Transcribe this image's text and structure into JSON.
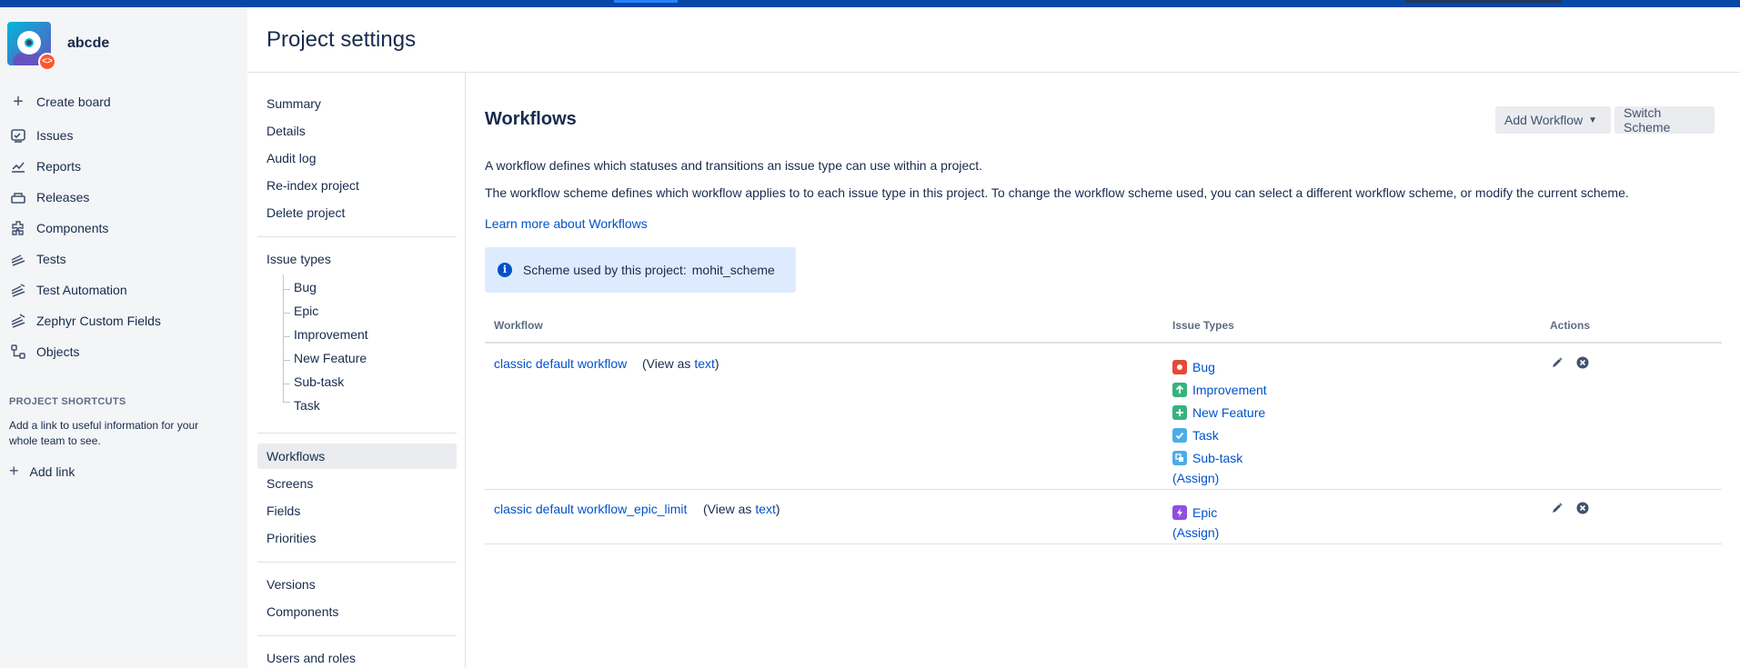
{
  "project": {
    "name": "abcde"
  },
  "sidebar": {
    "create_board": "Create board",
    "items": [
      {
        "label": "Issues",
        "icon": "issues-icon"
      },
      {
        "label": "Reports",
        "icon": "reports-icon"
      },
      {
        "label": "Releases",
        "icon": "releases-icon"
      },
      {
        "label": "Components",
        "icon": "components-icon"
      },
      {
        "label": "Tests",
        "icon": "tests-icon"
      },
      {
        "label": "Test Automation",
        "icon": "test-automation-icon"
      },
      {
        "label": "Zephyr Custom Fields",
        "icon": "zephyr-custom-fields-icon"
      },
      {
        "label": "Objects",
        "icon": "objects-icon"
      }
    ],
    "shortcuts_title": "PROJECT SHORTCUTS",
    "shortcuts_desc": "Add a link to useful information for your whole team to see.",
    "add_link": "Add link"
  },
  "page": {
    "title": "Project settings"
  },
  "settings_nav": {
    "summary": "Summary",
    "details": "Details",
    "audit_log": "Audit log",
    "reindex": "Re-index project",
    "delete": "Delete project",
    "issue_types": "Issue types",
    "issue_type_children": [
      "Bug",
      "Epic",
      "Improvement",
      "New Feature",
      "Sub-task",
      "Task"
    ],
    "workflows": "Workflows",
    "screens": "Screens",
    "fields": "Fields",
    "priorities": "Priorities",
    "versions": "Versions",
    "components": "Components",
    "users_roles": "Users and roles"
  },
  "main": {
    "title": "Workflows",
    "add_workflow": "Add Workflow",
    "switch_scheme": "Switch Scheme",
    "desc1": "A workflow defines which statuses and transitions an issue type can use within a project.",
    "desc2": "The workflow scheme defines which workflow applies to to each issue type in this project. To change the workflow scheme used, you can select a different workflow scheme, or modify the current scheme.",
    "learn_more": "Learn more about Workflows",
    "scheme_label": "Scheme used by this project:",
    "scheme_name": "mohit_scheme"
  },
  "table": {
    "col_workflow": "Workflow",
    "col_issue_types": "Issue Types",
    "col_actions": "Actions",
    "view_prefix": "(View as ",
    "view_link": "text",
    "view_suffix": ")",
    "assign": "(Assign)",
    "rows": [
      {
        "name": "classic default workflow",
        "issue_types": [
          {
            "label": "Bug",
            "color": "#e5493a"
          },
          {
            "label": "Improvement",
            "color": "#36b37e"
          },
          {
            "label": "New Feature",
            "color": "#36b37e"
          },
          {
            "label": "Task",
            "color": "#4bade8"
          },
          {
            "label": "Sub-task",
            "color": "#4bade8"
          }
        ]
      },
      {
        "name": "classic default workflow_epic_limit",
        "issue_types": [
          {
            "label": "Epic",
            "color": "#904ee2"
          }
        ]
      }
    ]
  },
  "colors": {
    "link": "#0052cc",
    "topbar": "#0747a6",
    "info_bg": "#deebff"
  }
}
